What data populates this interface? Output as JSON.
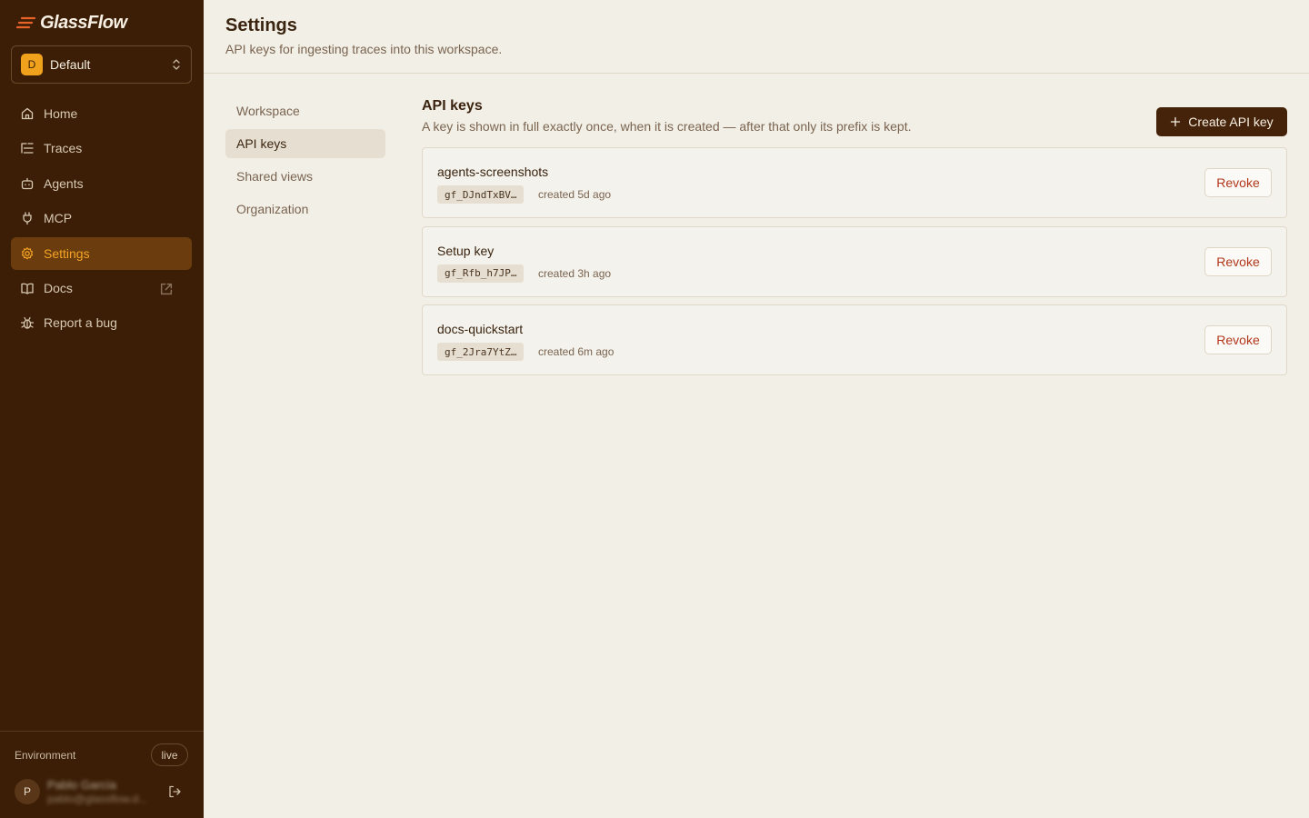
{
  "app": {
    "name": "GlassFlow"
  },
  "workspace": {
    "initial": "D",
    "name": "Default"
  },
  "nav": {
    "items": [
      {
        "label": "Home",
        "icon": "home-icon"
      },
      {
        "label": "Traces",
        "icon": "traces-icon"
      },
      {
        "label": "Agents",
        "icon": "robot-icon"
      },
      {
        "label": "MCP",
        "icon": "plug-icon"
      },
      {
        "label": "Settings",
        "icon": "gear-icon",
        "active": true
      },
      {
        "label": "Docs",
        "icon": "book-icon",
        "external": true
      },
      {
        "label": "Report a bug",
        "icon": "bug-icon"
      }
    ]
  },
  "environment": {
    "label": "Environment",
    "value": "live"
  },
  "user": {
    "initial": "P",
    "name": "Pablo García",
    "email": "pablo@glassflow.d..."
  },
  "header": {
    "title": "Settings",
    "subtitle": "API keys for ingesting traces into this workspace."
  },
  "subnav": {
    "items": [
      {
        "label": "Workspace"
      },
      {
        "label": "API keys",
        "active": true
      },
      {
        "label": "Shared views"
      },
      {
        "label": "Organization"
      }
    ]
  },
  "api_keys": {
    "title": "API keys",
    "subtitle": "A key is shown in full exactly once, when it is created — after that only its prefix is kept.",
    "create_label": "Create API key",
    "revoke_label": "Revoke",
    "keys": [
      {
        "name": "agents-screenshots",
        "prefix": "gf_DJndTxBV…",
        "created": "created 5d ago"
      },
      {
        "name": "Setup key",
        "prefix": "gf_Rfb_h7JP…",
        "created": "created 3h ago"
      },
      {
        "name": "docs-quickstart",
        "prefix": "gf_2Jra7YtZ…",
        "created": "created 6m ago"
      }
    ]
  },
  "colors": {
    "sidebar": "#3b1e05",
    "accent": "#f5a524",
    "danger": "#b2361a",
    "background": "#f2efe6"
  }
}
